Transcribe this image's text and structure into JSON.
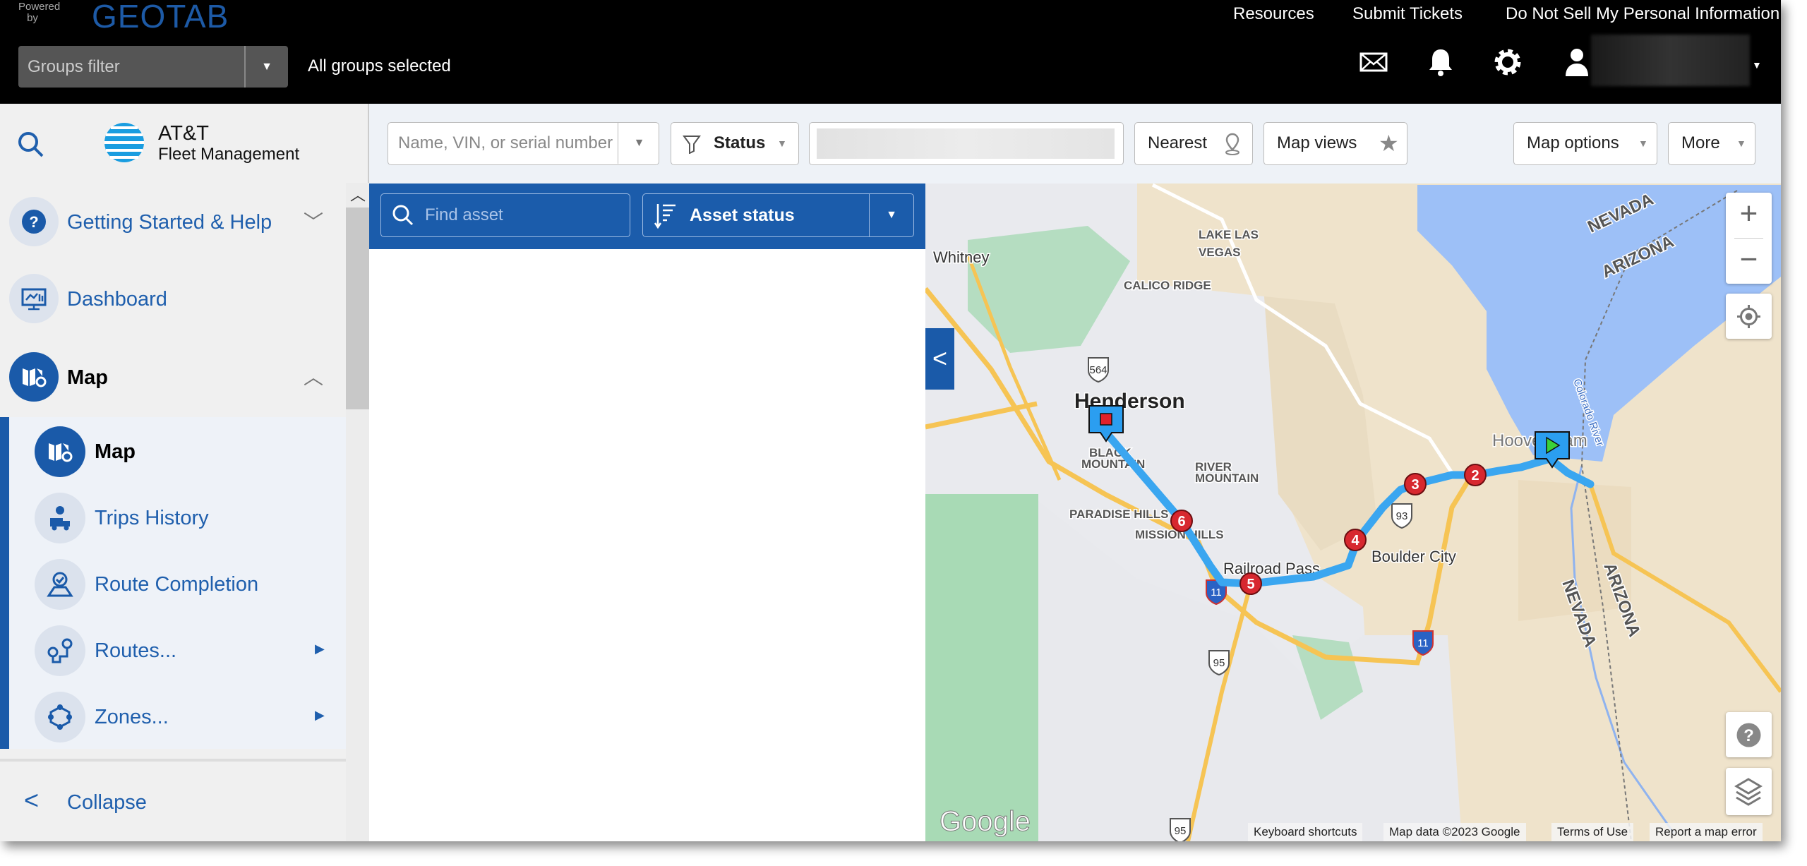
{
  "header": {
    "powered_by": "Powered by",
    "logo": "GEOTAB",
    "links": [
      "Resources",
      "Submit Tickets",
      "Do Not Sell My Personal Information"
    ],
    "groups_filter_placeholder": "Groups filter",
    "groups_status": "All groups selected",
    "icons": [
      "mail-icon",
      "bell-icon",
      "gear-icon",
      "user-icon"
    ]
  },
  "sidebar": {
    "brand_line1": "AT&T",
    "brand_line2": "Fleet Management",
    "items": [
      {
        "label": "Getting Started & Help",
        "icon": "help-icon",
        "expanded": false
      },
      {
        "label": "Dashboard",
        "icon": "dashboard-icon"
      },
      {
        "label": "Map",
        "icon": "map-icon",
        "expanded": true
      }
    ],
    "subitems": [
      {
        "label": "Map",
        "icon": "map-icon",
        "active": true
      },
      {
        "label": "Trips History",
        "icon": "trips-icon"
      },
      {
        "label": "Route Completion",
        "icon": "route-completion-icon"
      },
      {
        "label": "Routes...",
        "icon": "routes-icon",
        "submenu": true
      },
      {
        "label": "Zones...",
        "icon": "zones-icon",
        "submenu": true
      }
    ],
    "collapse_label": "Collapse"
  },
  "toolbar": {
    "search_placeholder": "Name, VIN, or serial number",
    "status_label": "Status",
    "nearest_label": "Nearest",
    "map_views_label": "Map views",
    "map_options_label": "Map options",
    "more_label": "More"
  },
  "asset_panel": {
    "find_placeholder": "Find asset",
    "sort_label": "Asset status"
  },
  "map": {
    "colors": {
      "route": "#3aa6f0",
      "water": "#9dc0f7",
      "park": "#a8dab5",
      "highway": "#f6c454",
      "stop": "#d7282f"
    },
    "labels": [
      {
        "text": "Whitney",
        "style": "city"
      },
      {
        "text": "LAKE LAS",
        "style": "area"
      },
      {
        "text": "VEGAS",
        "style": "area"
      },
      {
        "text": "CALICO RIDGE",
        "style": "area"
      },
      {
        "text": "Henderson",
        "style": "major"
      },
      {
        "text": "BLACK",
        "style": "area"
      },
      {
        "text": "MOUNTAIN",
        "style": "area"
      },
      {
        "text": "RIVER",
        "style": "area"
      },
      {
        "text": "MOUNTAIN",
        "style": "area"
      },
      {
        "text": "PARADISE HILLS",
        "style": "area"
      },
      {
        "text": "MISSION HILLS",
        "style": "area"
      },
      {
        "text": "Railroad Pass",
        "style": "city"
      },
      {
        "text": "Boulder City",
        "style": "city"
      },
      {
        "text": "Hoover Dam",
        "style": "poi"
      },
      {
        "text": "NEVADA",
        "style": "state"
      },
      {
        "text": "ARIZONA",
        "style": "state"
      },
      {
        "text": "ARIZONA",
        "style": "state"
      },
      {
        "text": "NEVADA",
        "style": "state"
      },
      {
        "text": "Colorado River",
        "style": "water"
      }
    ],
    "shields": [
      "564",
      "95",
      "95",
      "11",
      "11",
      "93"
    ],
    "stops": [
      "2",
      "3",
      "4",
      "5",
      "6"
    ],
    "google_logo": "Google",
    "attribution": [
      "Keyboard shortcuts",
      "Map data ©2023 Google",
      "Terms of Use",
      "Report a map error"
    ]
  }
}
